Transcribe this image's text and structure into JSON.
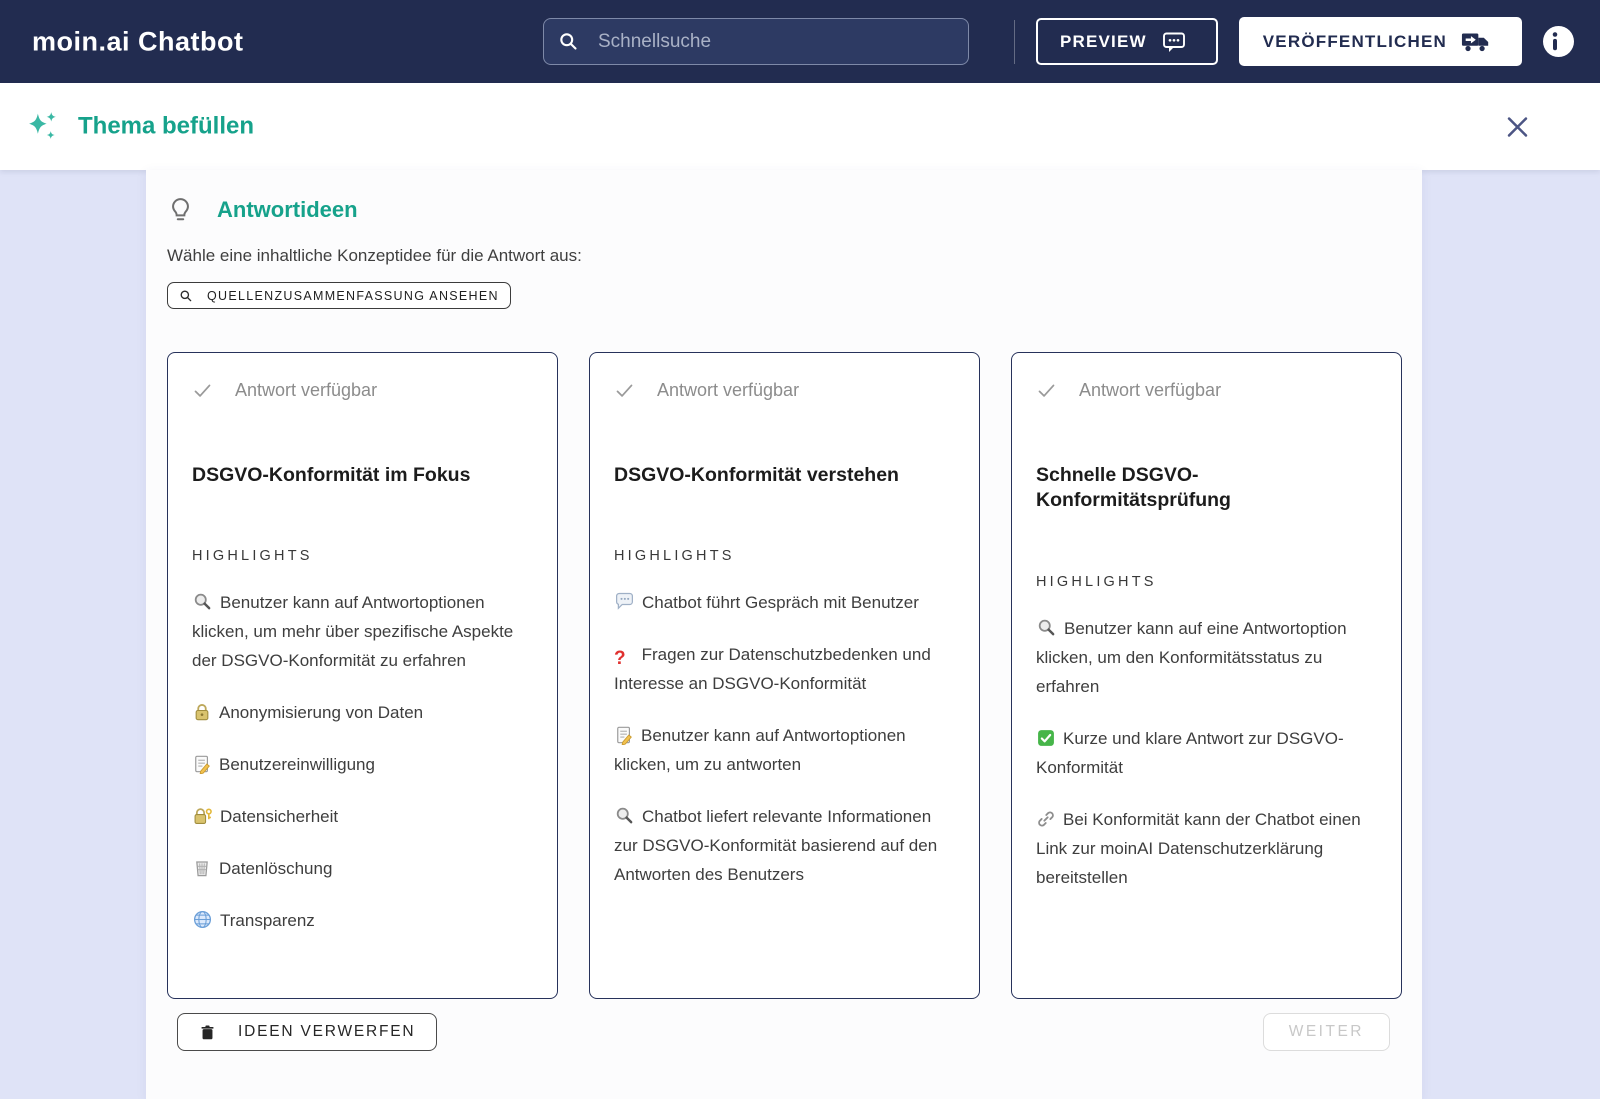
{
  "navbar": {
    "logo": "moin.ai Chatbot",
    "search_placeholder": "Schnellsuche",
    "preview_label": "PREVIEW",
    "publish_label": "VERÖFFENTLICHEN"
  },
  "subheader": {
    "title": "Thema befüllen"
  },
  "main": {
    "section_title": "Antwortideen",
    "subtitle": "Wähle eine inhaltliche Konzeptidee für die Antwort aus:",
    "source_chip_label": "QUELLENZUSAMMENFASSUNG ANSEHEN",
    "cards": [
      {
        "status": "Antwort verfügbar",
        "title": "DSGVO-Konformität im Fokus",
        "highlights_label": "HIGHLIGHTS",
        "items": [
          {
            "icon": "magnifier",
            "text": "Benutzer kann auf Antwortoptionen klicken, um mehr über spezifische Aspekte der DSGVO-Konformität zu erfahren"
          },
          {
            "icon": "lock",
            "text": "Anonymisierung von Daten"
          },
          {
            "icon": "memo",
            "text": "Benutzereinwilligung"
          },
          {
            "icon": "lock-key",
            "text": "Datensicherheit"
          },
          {
            "icon": "wastebasket",
            "text": "Datenlöschung"
          },
          {
            "icon": "globe",
            "text": "Transparenz"
          }
        ]
      },
      {
        "status": "Antwort verfügbar",
        "title": "DSGVO-Konformität verstehen",
        "highlights_label": "HIGHLIGHTS",
        "items": [
          {
            "icon": "speech",
            "text": "Chatbot führt Gespräch mit Benutzer"
          },
          {
            "icon": "question-red",
            "text": "Fragen zur Datenschutzbedenken und Interesse an DSGVO-Konformität"
          },
          {
            "icon": "memo",
            "text": "Benutzer kann auf Antwortoptionen klicken, um zu antworten"
          },
          {
            "icon": "magnifier",
            "text": "Chatbot liefert relevante Informationen zur DSGVO-Konformität basierend auf den Antworten des Benutzers"
          }
        ]
      },
      {
        "status": "Antwort verfügbar",
        "title": "Schnelle DSGVO-Konformitätsprüfung",
        "highlights_label": "HIGHLIGHTS",
        "items": [
          {
            "icon": "magnifier",
            "text": "Benutzer kann auf eine Antwortoption klicken, um den Konformitätsstatus zu erfahren"
          },
          {
            "icon": "check-green",
            "text": "Kurze und klare Antwort zur DSGVO-Konformität"
          },
          {
            "icon": "link",
            "text": "Bei Konformität kann der Chatbot einen Link zur moinAI Datenschutzerklärung bereitstellen"
          }
        ]
      }
    ],
    "discard_label": "IDEEN VERWERFEN",
    "next_label": "WEITER"
  },
  "colors": {
    "brand_navy": "#222c50",
    "accent_teal": "#16a28b",
    "background_lavender": "#dfe3f7",
    "status_grey": "#8c8c8c"
  }
}
